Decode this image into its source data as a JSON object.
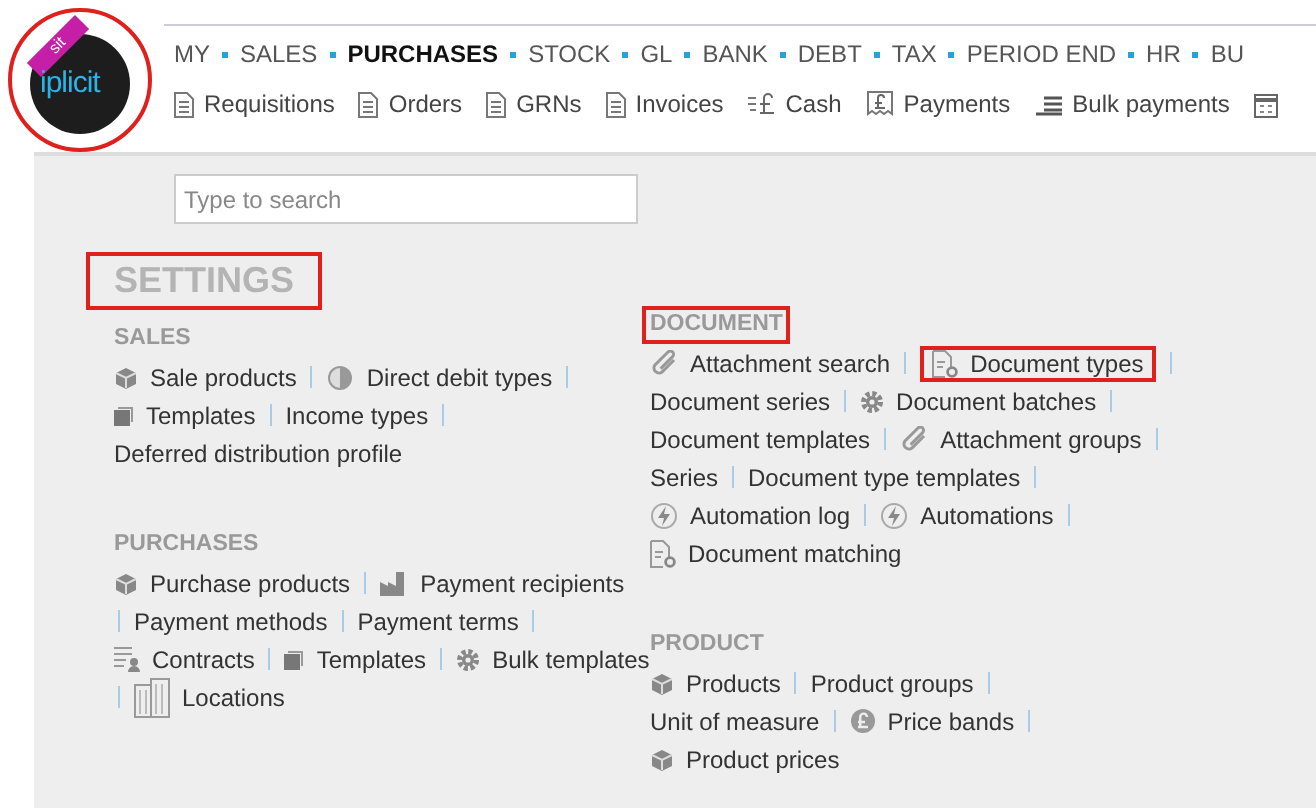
{
  "logo": {
    "text": "iplicit",
    "ribbon": "sit",
    "highlighted": true
  },
  "nav": [
    {
      "label": "MY",
      "selected": false
    },
    {
      "label": "SALES",
      "selected": false
    },
    {
      "label": "PURCHASES",
      "selected": true
    },
    {
      "label": "STOCK",
      "selected": false
    },
    {
      "label": "GL",
      "selected": false
    },
    {
      "label": "BANK",
      "selected": false
    },
    {
      "label": "DEBT",
      "selected": false
    },
    {
      "label": "TAX",
      "selected": false
    },
    {
      "label": "PERIOD END",
      "selected": false
    },
    {
      "label": "HR",
      "selected": false
    },
    {
      "label": "BU",
      "selected": false
    }
  ],
  "toolbar": [
    {
      "label": "Requisitions",
      "kind": "doc"
    },
    {
      "label": "Orders",
      "kind": "doc"
    },
    {
      "label": "GRNs",
      "kind": "doc"
    },
    {
      "label": "Invoices",
      "kind": "doc"
    },
    {
      "label": "Cash",
      "kind": "cash"
    },
    {
      "label": "Payments",
      "kind": "payment"
    },
    {
      "label": "Bulk payments",
      "kind": "bulk"
    },
    {
      "kind": "calendar"
    }
  ],
  "search": {
    "placeholder": "Type to search"
  },
  "title": {
    "text": "SETTINGS",
    "highlighted": true
  },
  "columns": [
    [
      {
        "heading": "SALES",
        "highlighted": false,
        "lines": [
          [
            {
              "label": "Sale products",
              "kind": "box",
              "sep": true,
              "highlighted": false
            },
            {
              "label": "Direct debit types",
              "kind": "disc",
              "sep": true,
              "highlighted": false
            }
          ],
          [
            {
              "label": "Templates",
              "kind": "square",
              "sep": true,
              "highlighted": false
            },
            {
              "label": "Income types",
              "kind": "plain",
              "sep": true,
              "highlighted": false
            }
          ],
          [
            {
              "label": "Deferred distribution profile",
              "kind": "plain",
              "sep": false,
              "highlighted": false
            }
          ]
        ]
      },
      {
        "heading": "PURCHASES",
        "highlighted": false,
        "lines": [
          [
            {
              "label": "Purchase products",
              "kind": "box",
              "sep": true,
              "highlighted": false
            },
            {
              "label": "Payment recipients",
              "kind": "factory",
              "sep": false,
              "highlighted": false
            }
          ],
          [
            {
              "label": "Payment methods",
              "kind": "lead",
              "sep": true,
              "highlighted": false
            },
            {
              "label": "Payment terms",
              "kind": "plain",
              "sep": true,
              "highlighted": false
            }
          ],
          [
            {
              "label": "Contracts",
              "kind": "contract",
              "sep": true,
              "highlighted": false
            },
            {
              "label": "Templates",
              "kind": "square",
              "sep": true,
              "highlighted": false
            },
            {
              "label": "Bulk templates",
              "kind": "gear",
              "sep": false,
              "highlighted": false
            }
          ],
          [
            {
              "label": "Locations",
              "kind": "building",
              "sep": false,
              "highlighted": false
            }
          ]
        ]
      }
    ],
    [
      {
        "heading": "DOCUMENT",
        "highlighted": true,
        "lines": [
          [
            {
              "label": "Attachment search",
              "kind": "clip",
              "sep": true,
              "highlighted": false
            },
            {
              "label": "Document types",
              "kind": "docgear",
              "sep": true,
              "highlighted": true
            }
          ],
          [
            {
              "label": "Document series",
              "kind": "plain",
              "sep": true,
              "highlighted": false
            },
            {
              "label": "Document batches",
              "kind": "gear",
              "sep": true,
              "highlighted": false
            }
          ],
          [
            {
              "label": "Document templates",
              "kind": "plain",
              "sep": true,
              "highlighted": false
            },
            {
              "label": "Attachment groups",
              "kind": "clip",
              "sep": true,
              "highlighted": false
            }
          ],
          [
            {
              "label": "Series",
              "kind": "plain",
              "sep": true,
              "highlighted": false
            },
            {
              "label": "Document type templates",
              "kind": "plain",
              "sep": true,
              "highlighted": false
            }
          ],
          [
            {
              "label": "Automation log",
              "kind": "bolt",
              "sep": true,
              "highlighted": false
            },
            {
              "label": "Automations",
              "kind": "bolt",
              "sep": true,
              "highlighted": false
            }
          ],
          [
            {
              "label": "Document matching",
              "kind": "docgear",
              "sep": false,
              "highlighted": false
            }
          ]
        ]
      },
      {
        "heading": "PRODUCT",
        "highlighted": false,
        "lines": [
          [
            {
              "label": "Products",
              "kind": "box",
              "sep": true,
              "highlighted": false
            },
            {
              "label": "Product groups",
              "kind": "plain",
              "sep": true,
              "highlighted": false
            }
          ],
          [
            {
              "label": "Unit of measure",
              "kind": "plain",
              "sep": true,
              "highlighted": false
            },
            {
              "label": "Price bands",
              "kind": "pound",
              "sep": true,
              "highlighted": false
            }
          ],
          [
            {
              "label": "Product prices",
              "kind": "box",
              "sep": false,
              "highlighted": false
            }
          ]
        ]
      }
    ]
  ]
}
